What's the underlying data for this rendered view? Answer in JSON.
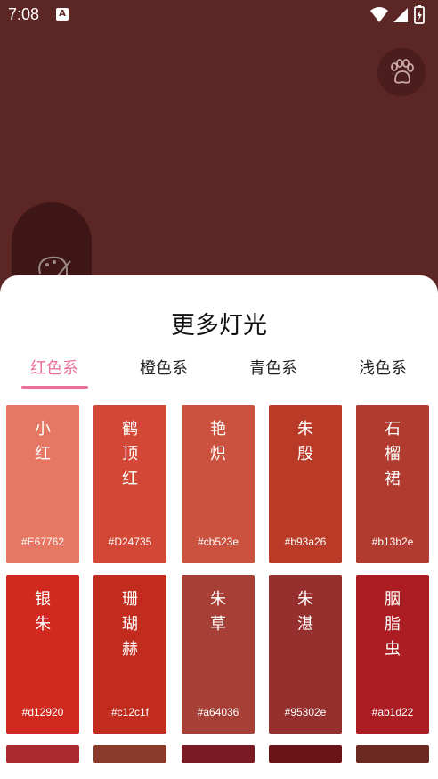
{
  "status": {
    "time": "7:08",
    "notification_letter": "A"
  },
  "sheet": {
    "title": "更多灯光",
    "tabs": [
      {
        "label": "红色系",
        "active": true
      },
      {
        "label": "橙色系",
        "active": false
      },
      {
        "label": "青色系",
        "active": false
      },
      {
        "label": "浅色系",
        "active": false
      }
    ]
  },
  "colors": [
    {
      "chars": [
        "小",
        "红"
      ],
      "hex": "#E67762",
      "color": "#e67762"
    },
    {
      "chars": [
        "鹤",
        "顶",
        "红"
      ],
      "hex": "#D24735",
      "color": "#d24735"
    },
    {
      "chars": [
        "艳",
        "炽"
      ],
      "hex": "#cb523e",
      "color": "#cb523e"
    },
    {
      "chars": [
        "朱",
        "殷"
      ],
      "hex": "#b93a26",
      "color": "#b93a26"
    },
    {
      "chars": [
        "石",
        "榴",
        "裙"
      ],
      "hex": "#b13b2e",
      "color": "#b13b2e"
    },
    {
      "chars": [
        "银",
        "朱"
      ],
      "hex": "#d12920",
      "color": "#d12920"
    },
    {
      "chars": [
        "珊",
        "瑚",
        "赫"
      ],
      "hex": "#c12c1f",
      "color": "#c12c1f"
    },
    {
      "chars": [
        "朱",
        "草"
      ],
      "hex": "#a64036",
      "color": "#a64036"
    },
    {
      "chars": [
        "朱",
        "湛"
      ],
      "hex": "#95302e",
      "color": "#95302e"
    },
    {
      "chars": [
        "胭",
        "脂",
        "虫"
      ],
      "hex": "#ab1d22",
      "color": "#ab1d22"
    }
  ],
  "partial_row": [
    {
      "color": "#a82a30"
    },
    {
      "color": "#8a3a2a"
    },
    {
      "color": "#7a1a22"
    },
    {
      "color": "#6b1418"
    },
    {
      "color": "#6a2a22"
    }
  ]
}
